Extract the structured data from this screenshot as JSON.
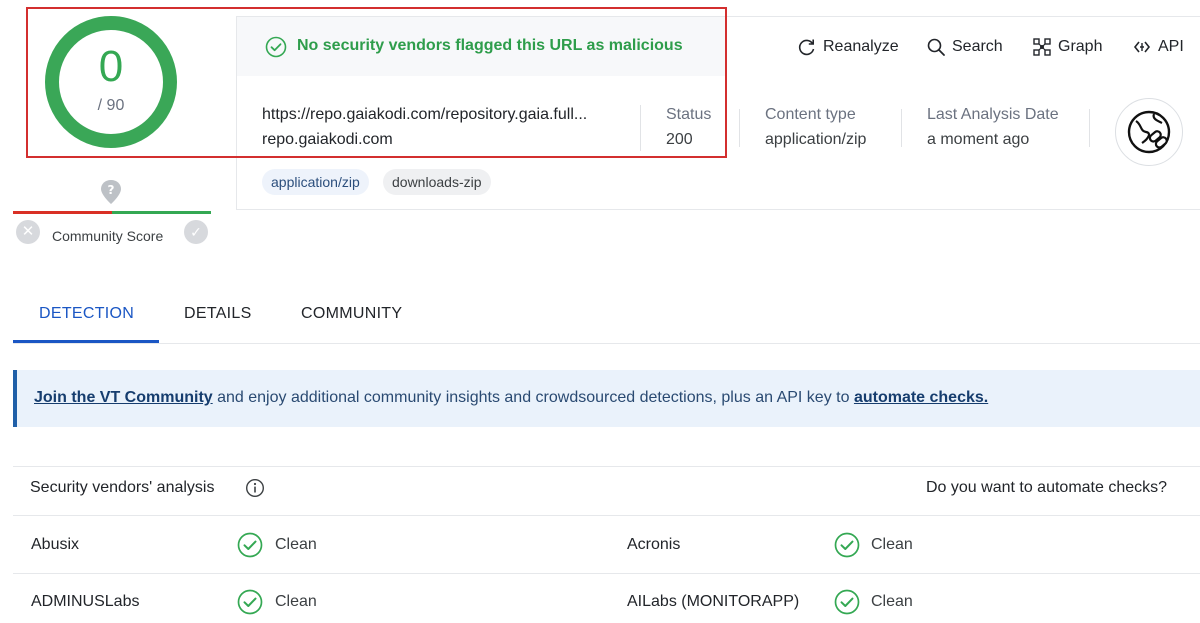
{
  "score": {
    "detections": "0",
    "total": "/ 90"
  },
  "community": {
    "label": "Community Score"
  },
  "banner": {
    "message": "No security vendors flagged this URL as malicious"
  },
  "actions": [
    {
      "label": "Reanalyze",
      "icon": "reanalyze-icon"
    },
    {
      "label": "Search",
      "icon": "search-icon"
    },
    {
      "label": "Graph",
      "icon": "graph-icon"
    },
    {
      "label": "API",
      "icon": "api-icon"
    }
  ],
  "url": {
    "full": "https://repo.gaiakodi.com/repository.gaia.full...",
    "host": "repo.gaiakodi.com"
  },
  "meta": {
    "status_label": "Status",
    "status_value": "200",
    "content_type_label": "Content type",
    "content_type_value": "application/zip",
    "last_analysis_label": "Last Analysis Date",
    "last_analysis_value": "a moment ago"
  },
  "tags": [
    "application/zip",
    "downloads-zip"
  ],
  "tabs": [
    "DETECTION",
    "DETAILS",
    "COMMUNITY"
  ],
  "cta": {
    "link1": "Join the VT Community",
    "middle": " and enjoy additional community insights and crowdsourced detections, plus an API key to ",
    "link2": "automate checks."
  },
  "vendors_table": {
    "title": "Security vendors' analysis",
    "right_prompt": "Do you want to automate checks?",
    "rows": [
      [
        {
          "vendor": "Abusix",
          "verdict": "Clean"
        },
        {
          "vendor": "Acronis",
          "verdict": "Clean"
        }
      ],
      [
        {
          "vendor": "ADMINUSLabs",
          "verdict": "Clean"
        },
        {
          "vendor": "AILabs (MONITORAPP)",
          "verdict": "Clean"
        }
      ]
    ]
  },
  "colors": {
    "clean_green": "#34a853",
    "accent_blue": "#1a56c4",
    "highlight_red": "#d32f2f"
  }
}
